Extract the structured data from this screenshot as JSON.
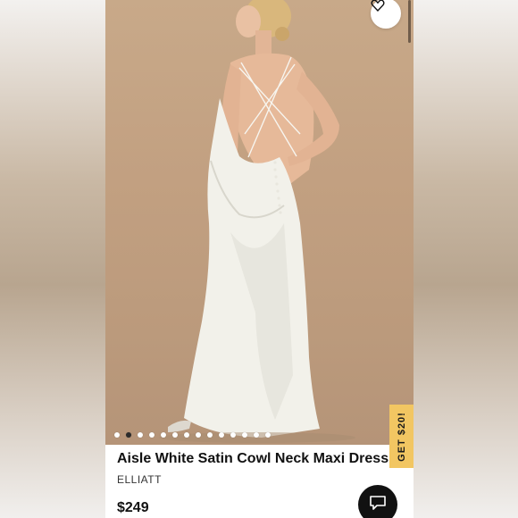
{
  "product": {
    "title": "Aisle White Satin Cowl Neck Maxi Dress",
    "brand": "ELLIATT",
    "price": "$249"
  },
  "promo": {
    "label": "GET $20!"
  },
  "gallery": {
    "image_count": 14,
    "active_index": 1
  },
  "icons": {
    "favorite": "heart-icon",
    "chat": "chat-bubble-icon"
  },
  "colors": {
    "promo_tab": "#f2c662",
    "chat_button": "#111111",
    "photo_background": "#c2a081",
    "dress": "#f2f1ea"
  }
}
